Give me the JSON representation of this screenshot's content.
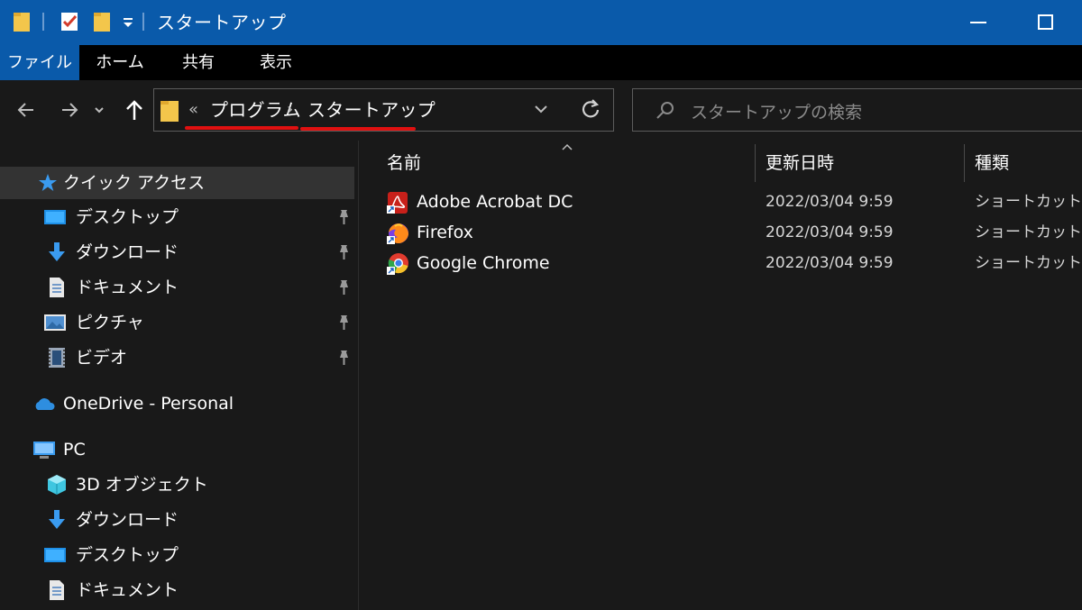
{
  "window": {
    "title": "スタートアップ"
  },
  "ribbon": {
    "tabs": [
      {
        "label": "ファイル",
        "active": true
      },
      {
        "label": "ホーム",
        "active": false
      },
      {
        "label": "共有",
        "active": false
      },
      {
        "label": "表示",
        "active": false
      }
    ]
  },
  "address": {
    "overflow": "«",
    "crumbs": [
      "プログラム",
      "スタートアップ"
    ],
    "separator": "›"
  },
  "search": {
    "placeholder": "スタートアップの検索"
  },
  "nav": {
    "quick_access": "クイック アクセス",
    "pinned": [
      {
        "label": "デスクトップ",
        "icon": "desktop-icon"
      },
      {
        "label": "ダウンロード",
        "icon": "download-icon"
      },
      {
        "label": "ドキュメント",
        "icon": "document-icon"
      },
      {
        "label": "ピクチャ",
        "icon": "pictures-icon"
      },
      {
        "label": "ビデオ",
        "icon": "video-icon"
      }
    ],
    "onedrive": "OneDrive - Personal",
    "pc": "PC",
    "pc_items": [
      {
        "label": "3D オブジェクト",
        "icon": "3d-objects-icon"
      },
      {
        "label": "ダウンロード",
        "icon": "download-icon"
      },
      {
        "label": "デスクトップ",
        "icon": "desktop-icon"
      },
      {
        "label": "ドキュメント",
        "icon": "document-icon"
      }
    ]
  },
  "filelist": {
    "columns": {
      "name": "名前",
      "modified": "更新日時",
      "type": "種類"
    },
    "files": [
      {
        "name": "Adobe Acrobat DC",
        "modified": "2022/03/04 9:59",
        "type": "ショートカット",
        "icon": "acrobat-icon"
      },
      {
        "name": "Firefox",
        "modified": "2022/03/04 9:59",
        "type": "ショートカット",
        "icon": "firefox-icon"
      },
      {
        "name": "Google Chrome",
        "modified": "2022/03/04 9:59",
        "type": "ショートカット",
        "icon": "chrome-icon"
      }
    ]
  },
  "colors": {
    "titlebar": "#0a5aaa",
    "background": "#191919",
    "highlight_underline": "#e01010"
  }
}
